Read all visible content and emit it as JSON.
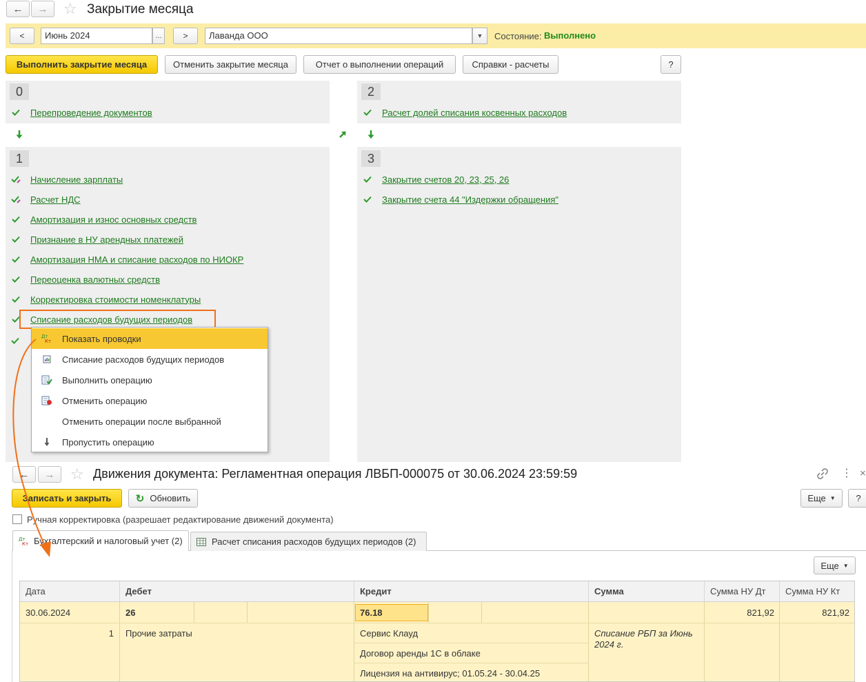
{
  "window": {
    "title": "Закрытие месяца",
    "back": "←",
    "forward": "→",
    "star": "☆"
  },
  "params": {
    "prev": "<",
    "next": ">",
    "period": "Июнь 2024",
    "period_btn": "...",
    "organization": "Лаванда ООО",
    "state_label": "Состояние:",
    "state_value": "Выполнено",
    "state_color": "#1f8a1f"
  },
  "toolbar": {
    "execute": "Выполнить закрытие месяца",
    "cancel": "Отменить закрытие месяца",
    "report": "Отчет о выполнении операций",
    "refs": "Справки - расчеты",
    "help": "?"
  },
  "stages": {
    "s0": {
      "num": "0",
      "ops": [
        "Перепроведение документов"
      ]
    },
    "s1": {
      "num": "1",
      "ops": [
        "Начисление зарплаты",
        "Расчет НДС",
        "Амортизация и износ основных средств",
        "Признание в НУ арендных платежей",
        "Амортизация НМА и списание расходов по НИОКР",
        "Переоценка валютных средств",
        "Корректировка стоимости номенклатуры",
        "Списание расходов будущих периодов"
      ]
    },
    "s2": {
      "num": "2",
      "ops": [
        "Расчет долей списания косвенных расходов"
      ]
    },
    "s3": {
      "num": "3",
      "ops": [
        "Закрытие счетов 20, 23, 25, 26",
        "Закрытие счета 44 \"Издержки обращения\""
      ]
    }
  },
  "context_menu": {
    "items": [
      "Показать проводки",
      "Списание расходов будущих периодов",
      "Выполнить операцию",
      "Отменить операцию",
      "Отменить операции после выбранной",
      "Пропустить операцию"
    ]
  },
  "doc": {
    "title": "Движения документа: Регламентная операция ЛВБП-000075 от 30.06.2024 23:59:59",
    "save_close": "Записать и закрыть",
    "refresh": "Обновить",
    "more": "Еще",
    "help": "?",
    "manual_label": "Ручная корректировка (разрешает редактирование движений документа)",
    "tabs": [
      "Бухгалтерский и налоговый учет (2)",
      "Расчет списания расходов будущих периодов (2)"
    ],
    "more2": "Еще"
  },
  "table": {
    "headers": [
      "Дата",
      "Дебет",
      "Кредит",
      "Сумма",
      "Сумма НУ Дт",
      "Сумма НУ Кт"
    ],
    "row": {
      "date": "30.06.2024",
      "debit": "26",
      "credit": "76.18",
      "nu_dt": "821,92",
      "nu_kt": "821,92",
      "line_no": "1",
      "debit_sub": "Прочие затраты",
      "credit_sub1": "Сервис Клауд",
      "credit_sub2": "Договор аренды 1С в облаке",
      "credit_sub3": "Лицензия на антивирус; 01.05.24 - 30.04.25",
      "content": "Списание РБП за Июнь 2024 г."
    }
  },
  "colors": {
    "accent_yellow": "#f5c800",
    "link_green": "#1e7a1e",
    "highlight_orange": "#f07018"
  }
}
